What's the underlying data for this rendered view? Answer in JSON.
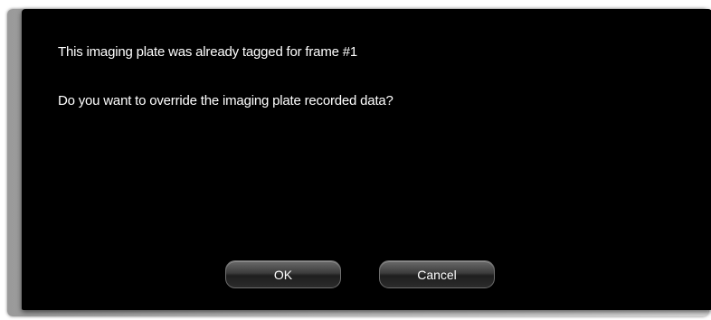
{
  "dialog": {
    "message_line_1": "This imaging plate was already tagged for frame #1",
    "message_line_2": "Do you want to override the imaging plate recorded data?",
    "ok_label": "OK",
    "cancel_label": "Cancel"
  },
  "colors": {
    "background": "#000000",
    "text": "#ffffff",
    "frame": "#bdbdbd"
  }
}
